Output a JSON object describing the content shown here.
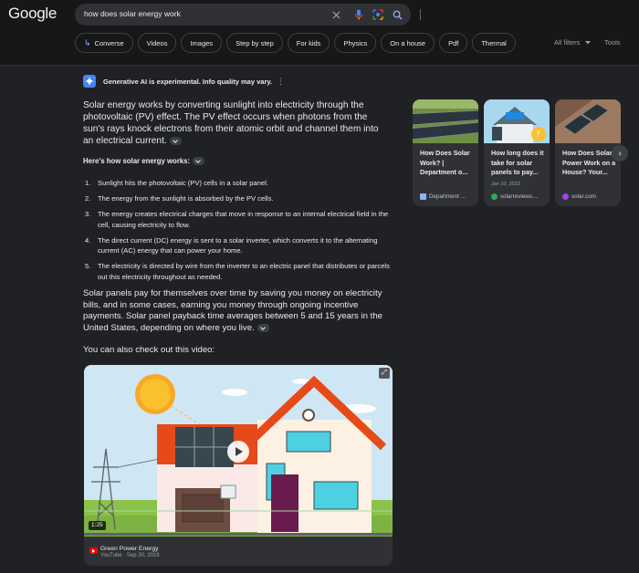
{
  "header": {
    "logo": "Google",
    "query": "how does solar energy work",
    "chips": [
      {
        "label": "Converse",
        "icon": "↳"
      },
      {
        "label": "Videos"
      },
      {
        "label": "Images"
      },
      {
        "label": "Step by step"
      },
      {
        "label": "For kids"
      },
      {
        "label": "Physics"
      },
      {
        "label": "On a house"
      },
      {
        "label": "Pdf"
      },
      {
        "label": "Thermal"
      }
    ],
    "all_filters": "All filters",
    "tools": "Tools"
  },
  "ai": {
    "note": "Generative AI is experimental. Info quality may vary.",
    "intro": "Solar energy works by converting sunlight into electricity through the photovoltaic (PV) effect. The PV effect occurs when photons from the sun's rays knock electrons from their atomic orbit and channel them into an electrical current.",
    "how_title": "Here's how solar energy works:",
    "steps": [
      "Sunlight hits the photovoltaic (PV) cells in a solar panel.",
      "The energy from the sunlight is absorbed by the PV cells.",
      "The energy creates electrical charges that move in response to an internal electrical field in the cell, causing electricity to flow.",
      "The direct current (DC) energy is sent to a solar inverter, which converts it to the alternating current (AC) energy that can power your home.",
      "The electricity is directed by wire from the inverter to an electric panel that distributes or parcels out this electricity throughout as needed."
    ],
    "payback": "Solar panels pay for themselves over time by saving you money on electricity bills, and in some cases, earning you money through ongoing incentive payments. Solar panel payback time averages between 5 and 15 years in the United States, depending on where you live.",
    "video_lead": "You can also check out this video:"
  },
  "video": {
    "duration": "1:25",
    "progress": 0,
    "channel": "Green Power Energy",
    "meta": "YouTube · Sep 30, 2019"
  },
  "cards": [
    {
      "title": "How Does Solar Work? | Department o...",
      "date": "",
      "source": "Department ...",
      "fav_color": "#8ab4f8"
    },
    {
      "title": "How long does it take for solar panels to pay...",
      "date": "Jan 10, 2023",
      "source": "solarreviews....",
      "fav_color": "#34a853"
    },
    {
      "title": "How Does Solar Power Work on a House? Your...",
      "date": "",
      "source": "solar.com",
      "fav_color": "#a142f4"
    }
  ],
  "colors": {
    "background": "#202124",
    "header": "#171717",
    "accent": "#8ab4f8",
    "text": "#e8eaed"
  }
}
